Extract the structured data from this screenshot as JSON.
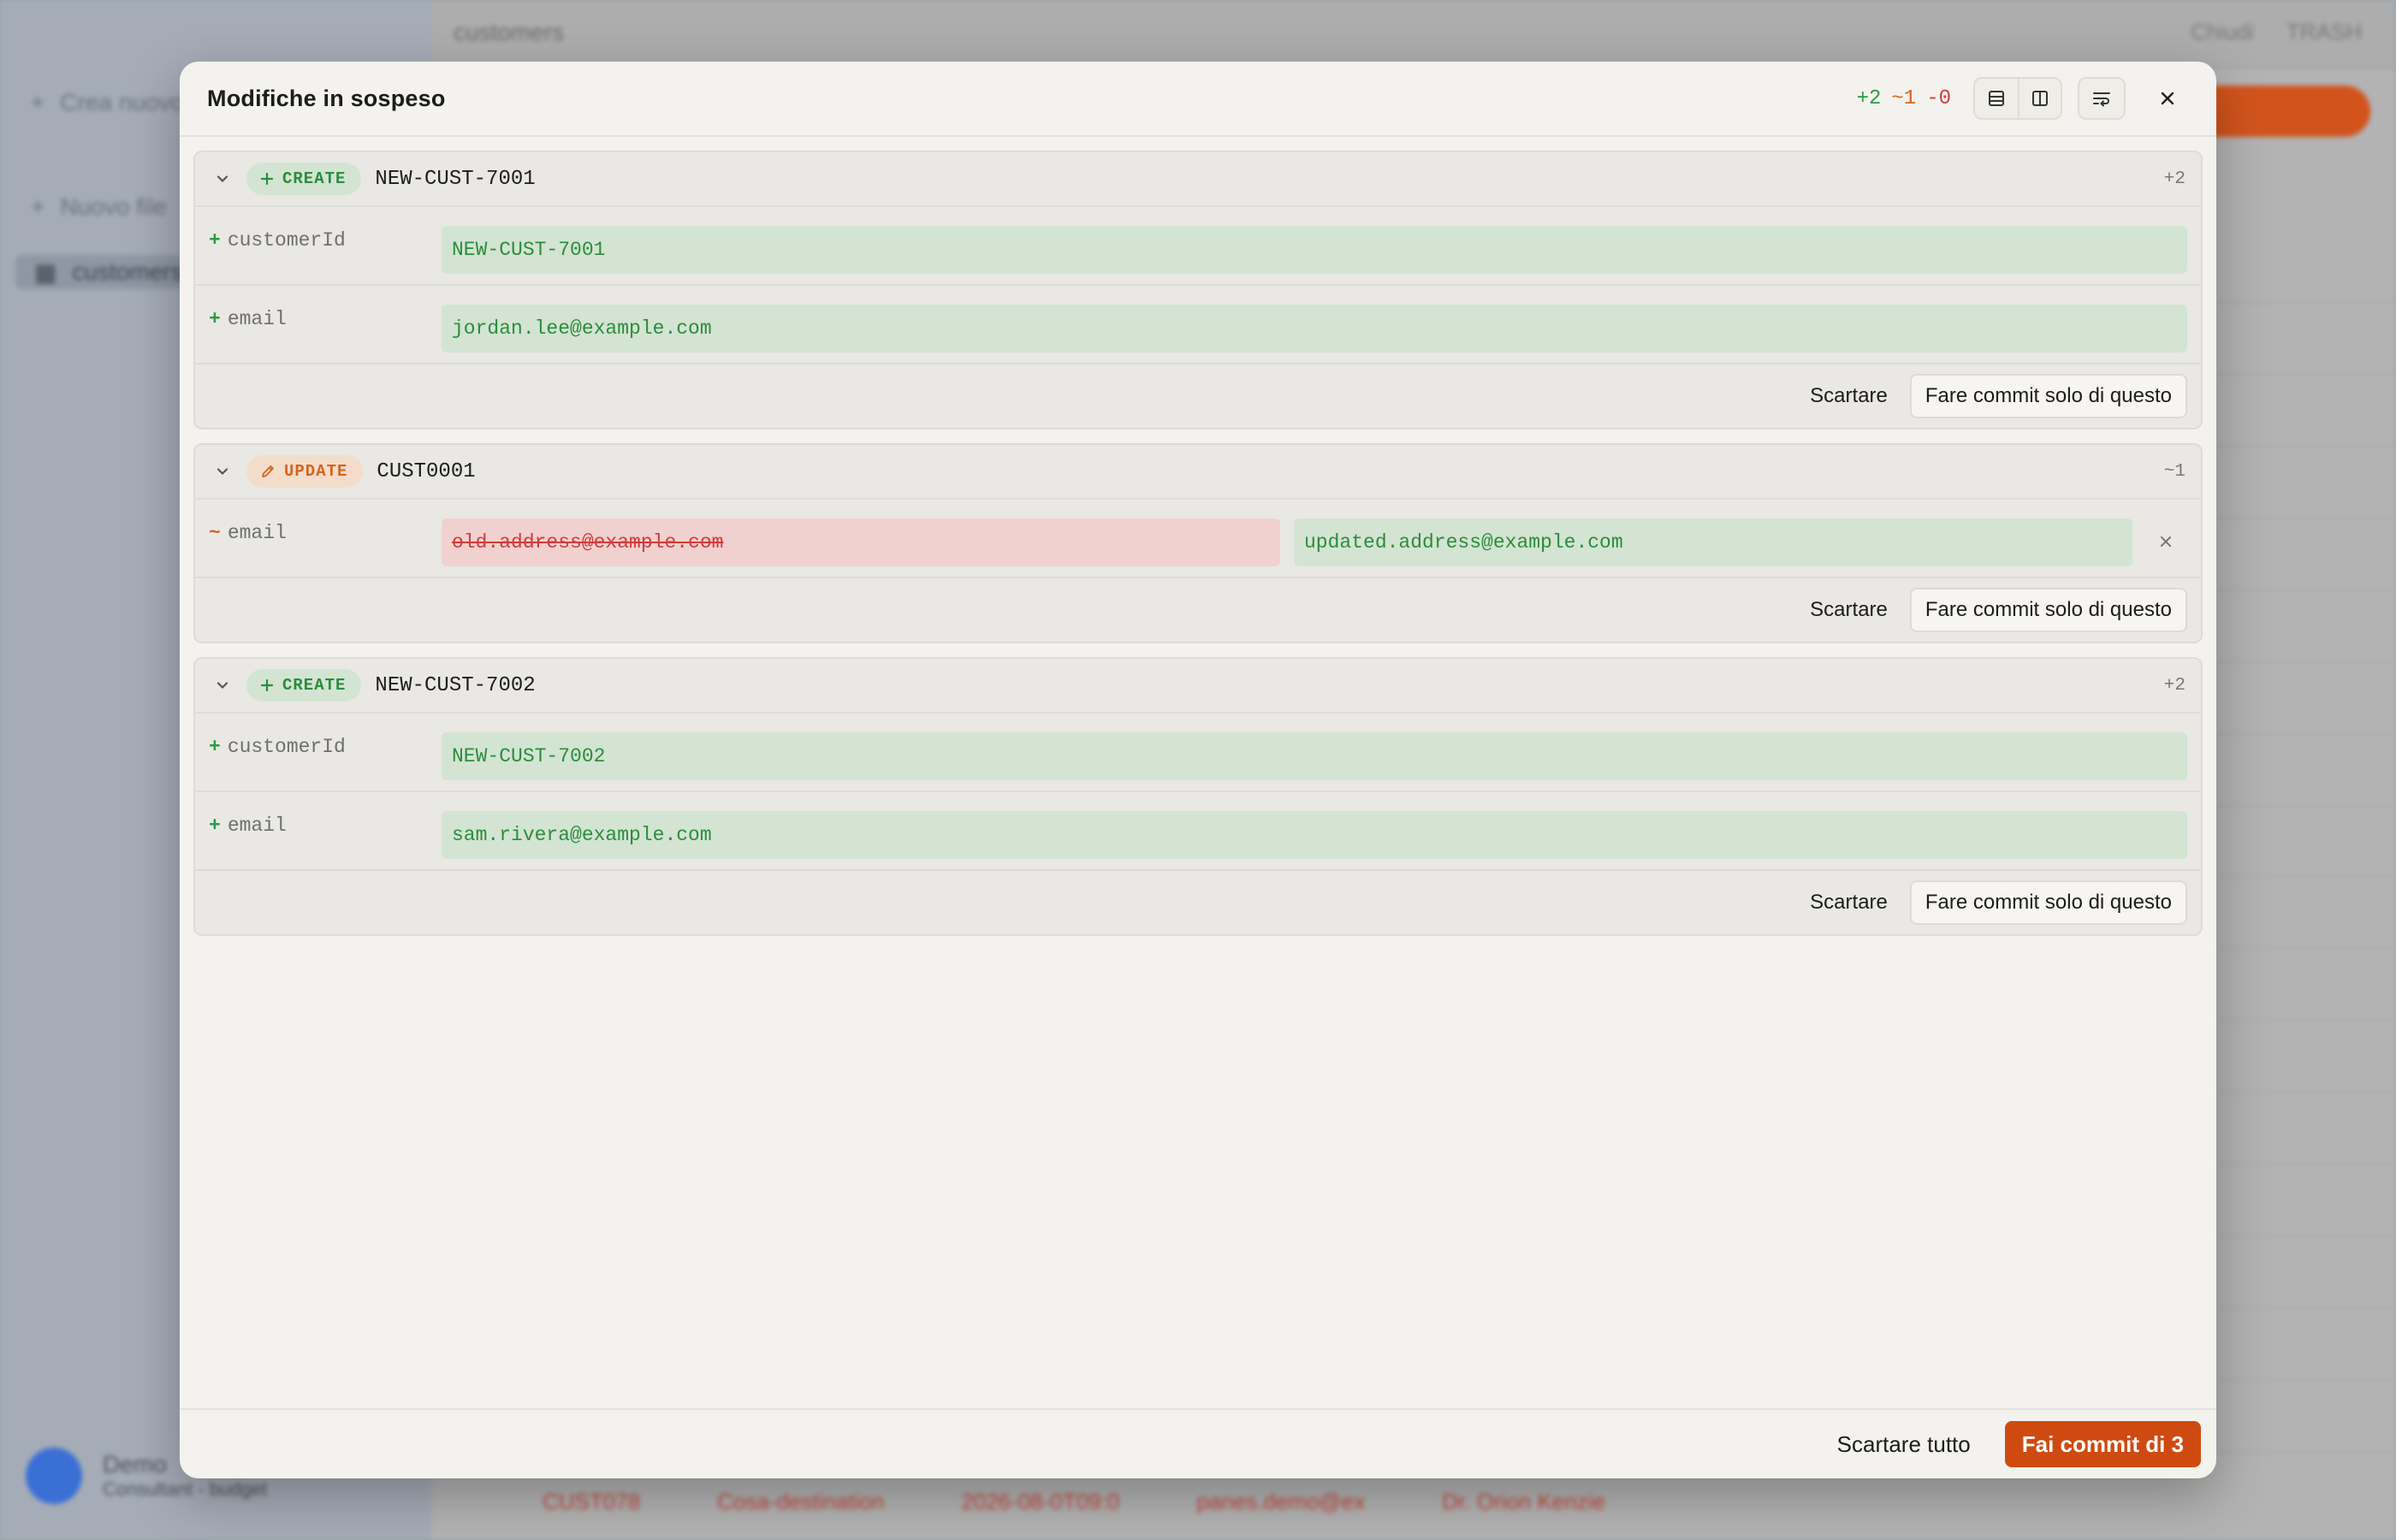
{
  "background": {
    "sidebar_items": [
      "Crea nuovo",
      "Nuovo file",
      "customers"
    ],
    "topbar_title": "customers",
    "topbar_right": [
      "Chiudi",
      "TRASH"
    ],
    "user_name": "Demo",
    "user_sub": "Consultant - budget",
    "bottom_row": [
      "CUST078",
      "Cosa-destination",
      "2026-08-0T09:0",
      "panes.demo@ex",
      "Dr. Orion Kenzie"
    ]
  },
  "modal": {
    "title": "Modifiche in sospeso",
    "stats": {
      "added": "+2",
      "modified": "~1",
      "deleted": "-0"
    },
    "colors": {
      "add": "#2f9a42",
      "modify": "#d4641e",
      "delete": "#d23c3c",
      "accent": "#cf4a10"
    },
    "icons": [
      "rows-layout-icon",
      "split-columns-icon",
      "wrap-text-icon",
      "close-icon"
    ]
  },
  "changes": [
    {
      "kind": "CREATE",
      "record_id": "NEW-CUST-7001",
      "count": "+2",
      "fields": [
        {
          "mark": "+",
          "name": "customerId",
          "new": "NEW-CUST-7001"
        },
        {
          "mark": "+",
          "name": "email",
          "new": "jordan.lee@example.com"
        }
      ]
    },
    {
      "kind": "UPDATE",
      "record_id": "CUST0001",
      "count": "~1",
      "fields": [
        {
          "mark": "~",
          "name": "email",
          "old": "old.address@example.com",
          "new": "updated.address@example.com"
        }
      ]
    },
    {
      "kind": "CREATE",
      "record_id": "NEW-CUST-7002",
      "count": "+2",
      "fields": [
        {
          "mark": "+",
          "name": "customerId",
          "new": "NEW-CUST-7002"
        },
        {
          "mark": "+",
          "name": "email",
          "new": "sam.rivera@example.com"
        }
      ]
    }
  ],
  "card_actions": {
    "discard": "Scartare",
    "commit_one": "Fare commit solo di questo"
  },
  "footer": {
    "discard_all": "Scartare tutto",
    "commit_all": "Fai commit di 3"
  }
}
